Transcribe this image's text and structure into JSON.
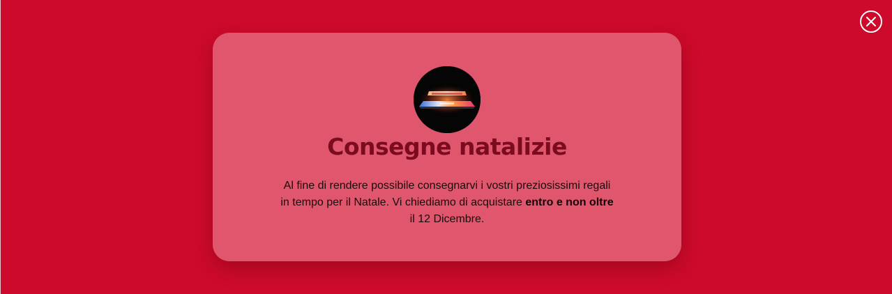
{
  "page": {
    "background_color": "#cd0a2b"
  },
  "close": {
    "icon": "close-icon",
    "color": "#ffffff"
  },
  "modal": {
    "background_color": "#df566d",
    "image": "laptop-glow-image",
    "title": "Consegne natalizie",
    "title_color": "#7b0b1f",
    "message": {
      "part1": "Al fine di rendere possibile consegnarvi i vostri preziosissimi regali in tempo per il Natale. Vi chiediamo di acquistare ",
      "emphasis": "entro e non oltre",
      "part2": " il 12 Dicembre."
    }
  }
}
